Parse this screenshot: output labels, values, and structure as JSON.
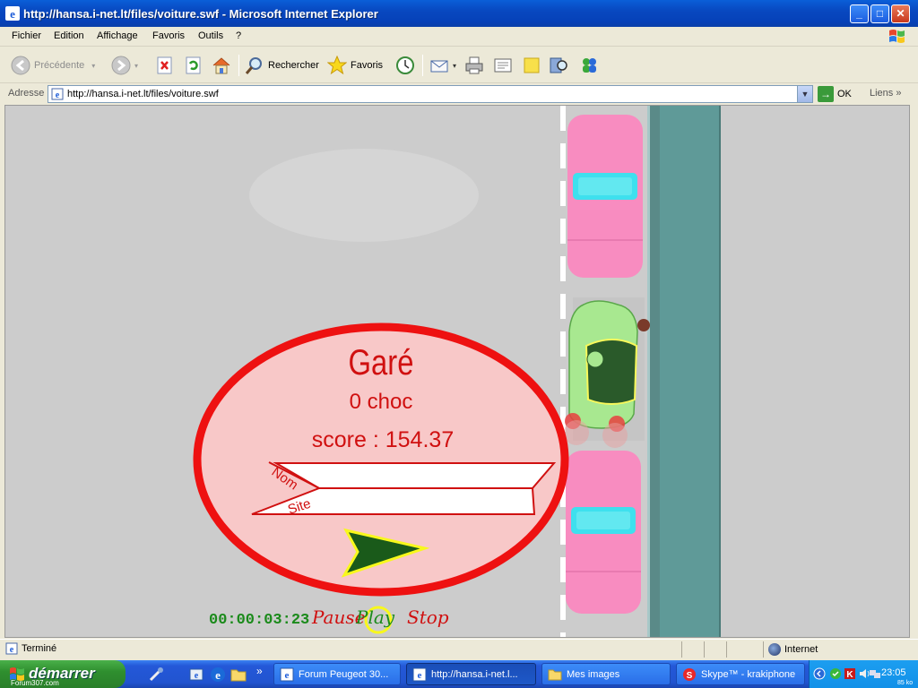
{
  "window": {
    "title": "http://hansa.i-net.lt/files/voiture.swf - Microsoft Internet Explorer",
    "minimize": "_",
    "maximize": "□",
    "close": "✕"
  },
  "menu": {
    "items": [
      "Fichier",
      "Edition",
      "Affichage",
      "Favoris",
      "Outils",
      "?"
    ]
  },
  "toolbar": {
    "back_label": "Précédente",
    "search_label": "Rechercher",
    "favorites_label": "Favoris"
  },
  "address": {
    "label": "Adresse",
    "url": "http://hansa.i-net.lt/files/voiture.swf",
    "go_label": "OK",
    "links_label": "Liens"
  },
  "game": {
    "result_title": "Garé",
    "shocks": "0 choc",
    "score": "score : 154.37",
    "name_label": "Nom",
    "site_label": "Site",
    "timer": "00:00:03:23",
    "pause_label": "Pause",
    "play_label": "Play",
    "stop_label": "Stop",
    "colors": {
      "road": "#cccccc",
      "parked_car": "#f88cc0",
      "player_car": "#a8e890",
      "sidewalk": "#5f9a98",
      "dialog_fill": "#f8c8c8",
      "dialog_border": "#ee1111",
      "text_red": "#d01010",
      "timer_green": "#1a8a1a"
    }
  },
  "status": {
    "text": "Terminé",
    "zone": "Internet"
  },
  "taskbar": {
    "start_label": "démarrer",
    "watermark": "Forum307.com",
    "tasks": [
      {
        "label": "Forum Peugeot 30...",
        "active": false
      },
      {
        "label": "http://hansa.i-net.l...",
        "active": true
      },
      {
        "label": "Mes images",
        "active": false
      },
      {
        "label": "Skype™ - krakiphone",
        "active": false
      }
    ],
    "overflow": "»",
    "clock": "23:05",
    "network_rate": "85 ko"
  }
}
